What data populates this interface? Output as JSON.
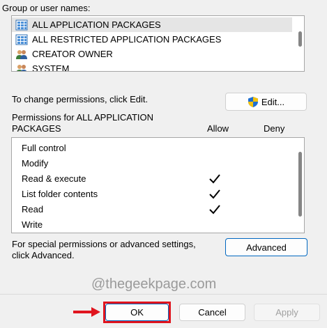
{
  "group_section": {
    "label": "Group or user names:",
    "items": [
      {
        "name": "ALL APPLICATION PACKAGES",
        "icon": "package-group-icon",
        "selected": true
      },
      {
        "name": "ALL RESTRICTED APPLICATION PACKAGES",
        "icon": "package-group-icon",
        "selected": false
      },
      {
        "name": "CREATOR OWNER",
        "icon": "users-icon",
        "selected": false
      },
      {
        "name": "SYSTEM",
        "icon": "users-icon",
        "selected": false
      }
    ]
  },
  "change_permissions": {
    "text": "To change permissions, click Edit.",
    "edit_label": "Edit..."
  },
  "permissions_section": {
    "title_line1": "Permissions for ALL APPLICATION",
    "title_line2": "PACKAGES",
    "allow_header": "Allow",
    "deny_header": "Deny",
    "rows": [
      {
        "name": "Full control",
        "allow": false,
        "deny": false
      },
      {
        "name": "Modify",
        "allow": false,
        "deny": false
      },
      {
        "name": "Read & execute",
        "allow": true,
        "deny": false
      },
      {
        "name": "List folder contents",
        "allow": true,
        "deny": false
      },
      {
        "name": "Read",
        "allow": true,
        "deny": false
      },
      {
        "name": "Write",
        "allow": false,
        "deny": false
      }
    ]
  },
  "advanced": {
    "text_line1": "For special permissions or advanced settings,",
    "text_line2": "click Advanced.",
    "button_label": "Advanced"
  },
  "watermark": "@thegeekpage.com",
  "footer": {
    "ok_label": "OK",
    "cancel_label": "Cancel",
    "apply_label": "Apply"
  },
  "colors": {
    "highlight": "#e0141e",
    "primary_border": "#0067c0",
    "selected_row": "#e5e5e5"
  }
}
